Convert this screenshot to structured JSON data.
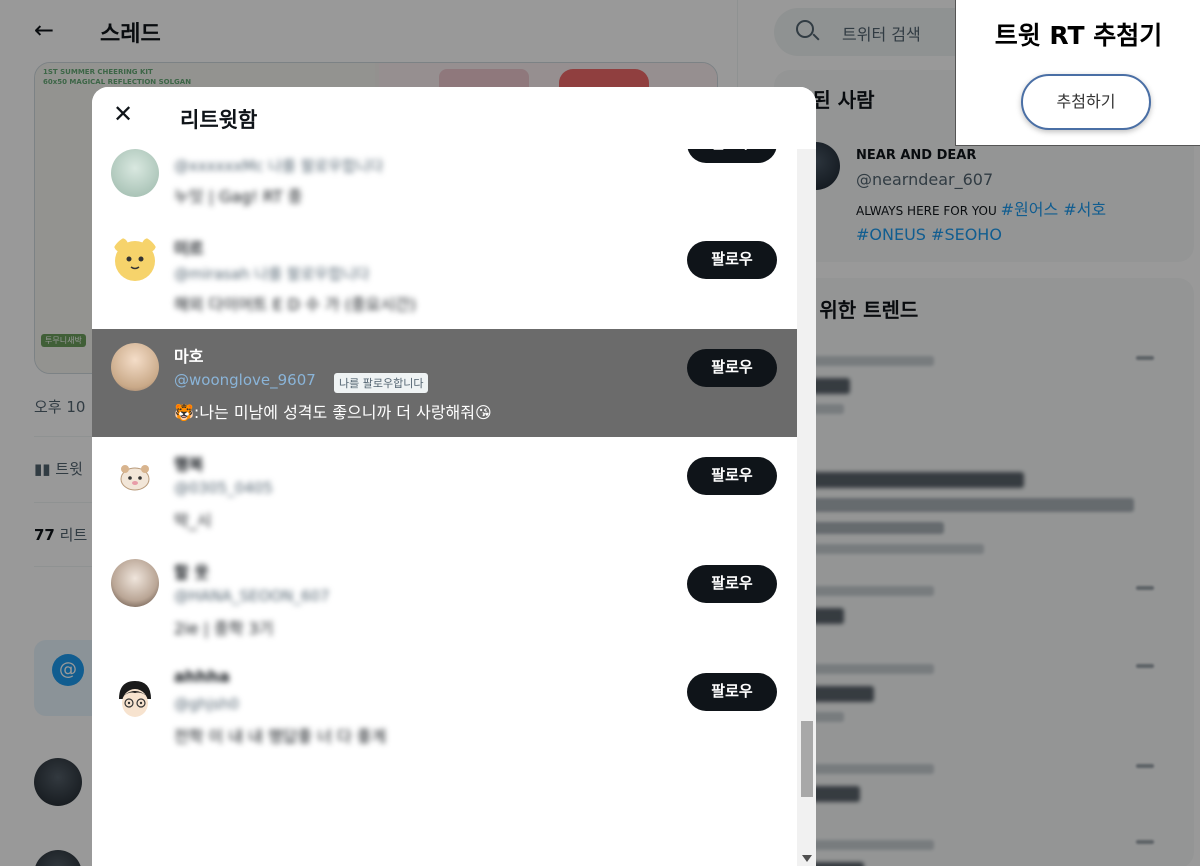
{
  "thread": {
    "back_icon": "back-arrow-icon",
    "title": "스레드",
    "time": "오후 10",
    "analytics": "트윗",
    "rt_count_num": "77",
    "rt_count_label": "리트"
  },
  "media": {
    "kit_line1": "1ST SUMMER CHEERING KIT",
    "kit_line2": "60x50 MAGICAL REFLECTION SOLGAN",
    "badge": "투무니새박"
  },
  "search": {
    "placeholder": "트위터 검색"
  },
  "related": {
    "title": "관된 사람",
    "name": "NEAR AND DEAR",
    "handle": "@nearndear_607",
    "bio_text": "ALWAYS HERE FOR YOU ",
    "tags1": "#원어스 #서호",
    "tags2": "#ONEUS #SEOHO"
  },
  "trends": {
    "title": "를 위한 트렌드"
  },
  "modal": {
    "title": "리트윗함",
    "close_icon": "close-icon",
    "follow_label": "팔로우",
    "users": [
      {
        "name": "",
        "handle": "@xxxxxxMc 나를 팔로우합니다",
        "bio": "누잇 | Gag! RT 중",
        "blurred": true
      },
      {
        "name": "미르",
        "handle": "@mirasah 나를 팔로우합니다",
        "bio": "해외 다이어트 E D 수 가 (중요시간)",
        "blurred": true
      },
      {
        "name": "마호",
        "handle": "@woonglove_9607",
        "bio": "🐯:나는 미남에 성격도 좋으니까 더 사랑해줘😘",
        "follows_you": "나를 팔로우합니다",
        "blurred": false
      },
      {
        "name": "행복",
        "handle": "@0305_0405",
        "bio": "막_시",
        "blurred": true
      },
      {
        "name": "할 웃",
        "handle": "@HANA_SEOON_607",
        "bio": "2ie | 중학 3기",
        "blurred": true
      },
      {
        "name": "ahhha",
        "handle": "@ghjsh0",
        "bio": "전학 이 내 내 행답좋 너 다 좋게",
        "blurred": true
      }
    ]
  },
  "extension": {
    "title": "트윗 RT 추첨기",
    "button": "추첨하기"
  }
}
